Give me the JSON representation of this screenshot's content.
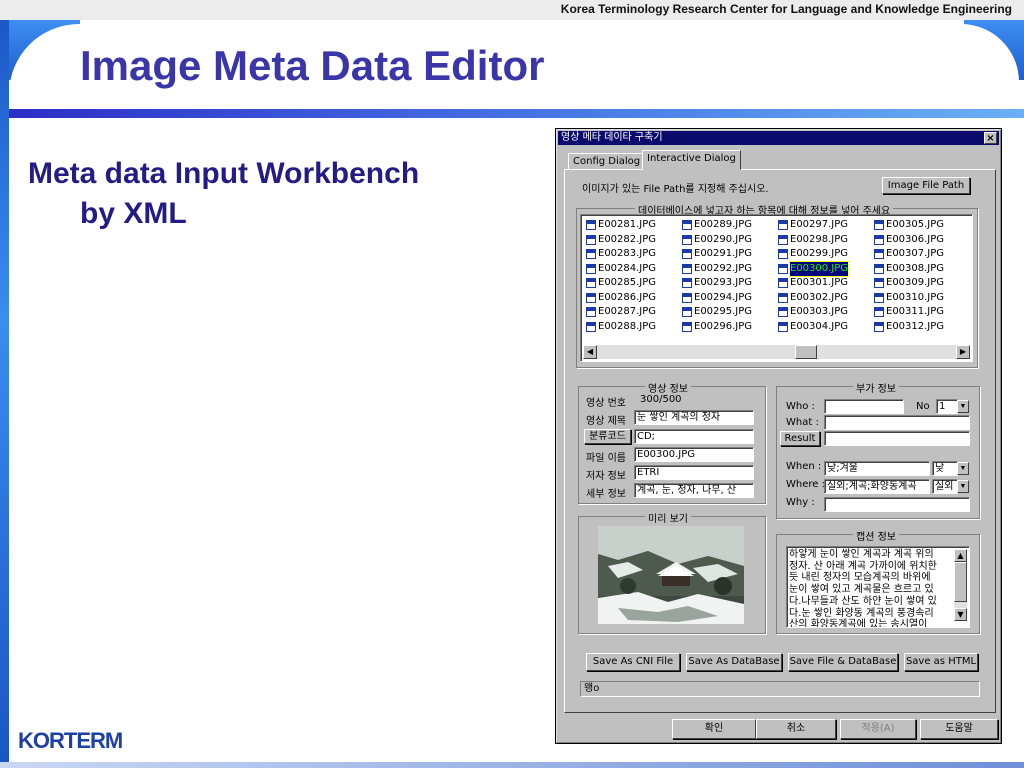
{
  "slide": {
    "header": "Korea Terminology Research Center for Language and Knowledge Engineering",
    "title": "Image Meta Data Editor",
    "bullet_line1": "Meta data Input Workbench",
    "bullet_line2": "by XML",
    "logo": "KORTERM"
  },
  "window": {
    "title": "영상 메타 데이타 구축기",
    "close_label": "×",
    "tabs": [
      "Config Dialog",
      "Interactive Dialog"
    ],
    "active_tab": "Interactive Dialog",
    "path_prompt": "이미지가 있는 File Path를 지정해 주십시오.",
    "image_file_path_button": "Image File Path",
    "list_caption": "데이터베이스에 넣고자 하는 항목에 대해 정보를 넣어 주세요",
    "files": [
      [
        "E00281.JPG",
        "E00282.JPG",
        "E00283.JPG",
        "E00284.JPG",
        "E00285.JPG",
        "E00286.JPG",
        "E00287.JPG",
        "E00288.JPG"
      ],
      [
        "E00289.JPG",
        "E00290.JPG",
        "E00291.JPG",
        "E00292.JPG",
        "E00293.JPG",
        "E00294.JPG",
        "E00295.JPG",
        "E00296.JPG"
      ],
      [
        "E00297.JPG",
        "E00298.JPG",
        "E00299.JPG",
        "E00300.JPG",
        "E00301.JPG",
        "E00302.JPG",
        "E00303.JPG",
        "E00304.JPG"
      ],
      [
        "E00305.JPG",
        "E00306.JPG",
        "E00307.JPG",
        "E00308.JPG",
        "E00309.JPG",
        "E00310.JPG",
        "E00311.JPG",
        "E00312.JPG"
      ]
    ],
    "selected_file": "E00300.JPG",
    "image_info": {
      "caption": "영상 정보",
      "number_label": "영상 번호",
      "number_value": "300/500",
      "title_label": "영상 제목",
      "title_value": "눈 쌓인 계곡의 정자",
      "category_button": "분류코드",
      "category_value": "CD;",
      "filename_label": "파일 이름",
      "filename_value": "E00300.JPG",
      "author_label": "저자 정보",
      "author_value": "ETRI",
      "detail_label": "세부 정보",
      "detail_value": "계곡, 눈, 정자, 나무, 산"
    },
    "extra_info": {
      "caption": "부가 정보",
      "who_label": "Who :",
      "who_value": "",
      "no_label": "No",
      "no_value": "1",
      "what_label": "What :",
      "what_value": "",
      "result_button": "Result",
      "result_value": "",
      "when_label": "When :",
      "when_value": "낮;겨울",
      "when_combo": "낮",
      "where_label": "Where :",
      "where_value": "실외;계곡;화양동계곡",
      "where_combo": "실외",
      "why_label": "Why :",
      "why_value": ""
    },
    "preview_caption": "미리 보기",
    "caption_info": {
      "caption": "캡션 정보",
      "lines": [
        "하얗게 눈이 쌓인 계곡과 계곡 위의",
        "정자. 산 아래 계곡 가까이에 위치한",
        "듯 내린 정자의 모습계곡의 바위에",
        "눈이 쌓여 있고 계곡물은 흐르고 있",
        "다.나무들과 산도 하얀 눈이 쌓여 있",
        "다.눈 쌓인 화양동 계곡의 풍경속리",
        "산의 화양동계곡에 있는 송시열이"
      ]
    },
    "save_buttons": [
      "Save As CNI File",
      "Save As DataBase",
      "Save File & DataBase",
      "Save as HTML"
    ],
    "status_text": "왱o",
    "bottom_buttons": [
      "확인",
      "취소",
      "적용(A)",
      "도움말"
    ]
  }
}
